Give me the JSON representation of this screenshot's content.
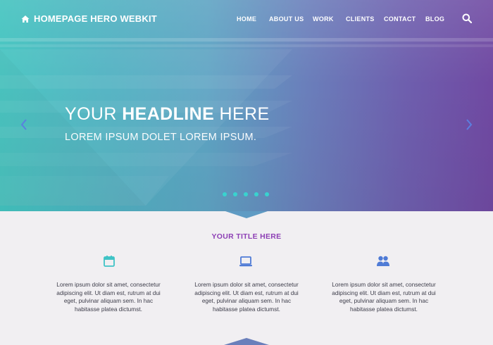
{
  "brand": {
    "title": "HOMEPAGE HERO WEBKIT",
    "icon": "home-icon"
  },
  "nav": {
    "items": [
      {
        "label": "HOME"
      },
      {
        "label": "ABOUT US"
      },
      {
        "label": "WORK"
      },
      {
        "label": "CLIENTS"
      },
      {
        "label": "CONTACT"
      },
      {
        "label": "BLOG"
      }
    ],
    "search_icon": "search-icon"
  },
  "hero": {
    "headline_pre": "YOUR ",
    "headline_bold": "HEADLINE",
    "headline_post": " HERE",
    "subline": "LOREM IPSUM DOLET LOREM IPSUM.",
    "slide_count": 5,
    "prev_icon": "chevron-left-icon",
    "next_icon": "chevron-right-icon"
  },
  "section": {
    "title": "YOUR TITLE HERE",
    "features": [
      {
        "icon": "calendar-icon",
        "text": "Lorem ipsum dolor sit amet, consectetur adipiscing elit. Ut diam est, rutrum at dui eget, pulvinar aliquam sem. In hac habitasse platea dictumst."
      },
      {
        "icon": "laptop-icon",
        "text": "Lorem ipsum dolor sit amet, consectetur adipiscing elit. Ut diam est, rutrum at dui eget, pulvinar aliquam sem. In hac habitasse platea dictumst."
      },
      {
        "icon": "users-icon",
        "text": "Lorem ipsum dolor sit amet, consectetur adipiscing elit. Ut diam est, rutrum at dui eget, pulvinar aliquam sem. In hac habitasse platea dictumst."
      }
    ]
  },
  "colors": {
    "accent": "#8d3fb5",
    "icon_blue": "#4f7bd6",
    "icon_teal": "#3fc3c6",
    "dot": "#39d3cf",
    "gradient_start": "#42c3bf",
    "gradient_end": "#7049a2"
  }
}
